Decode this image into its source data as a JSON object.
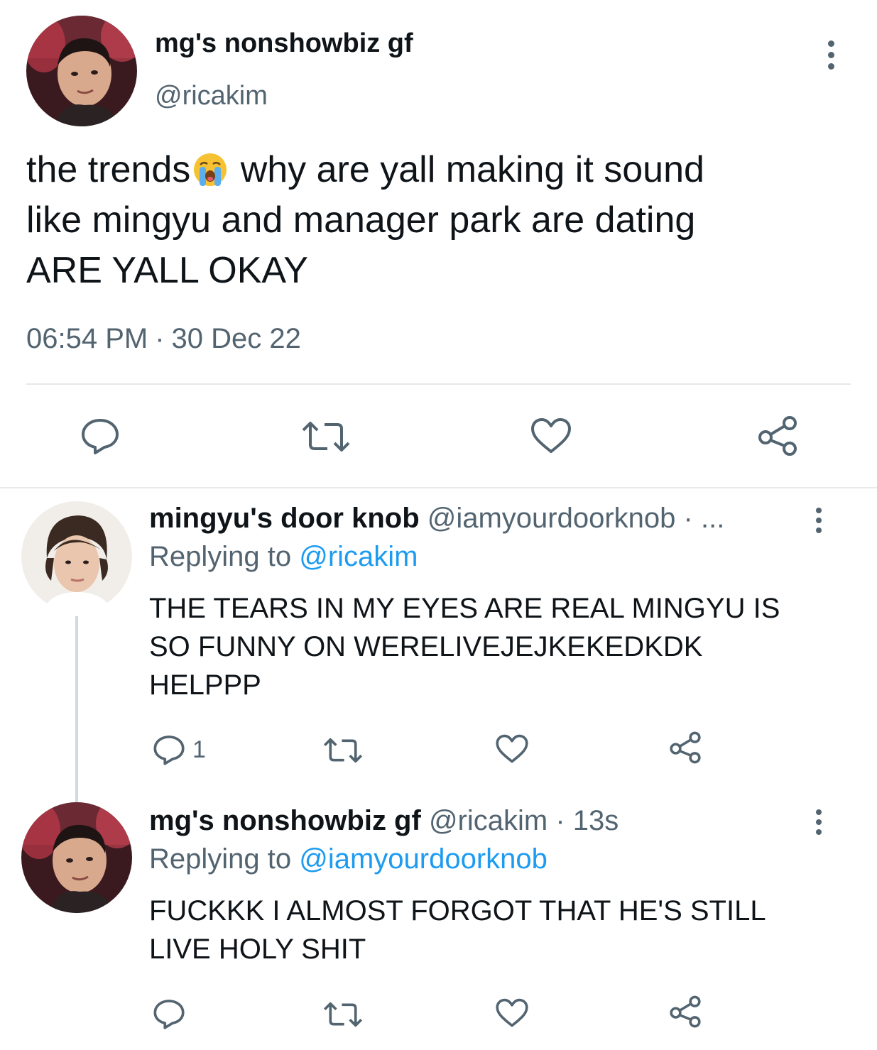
{
  "main_tweet": {
    "display_name": "mg's nonshowbiz gf",
    "handle": "@ricakim",
    "text_lines": [
      "the trends",
      " why are yall making it sound",
      "like mingyu and manager park are dating",
      "ARE YALL OKAY"
    ],
    "emoji_icon": "loudly-crying-face-emoji",
    "time": "06:54 PM",
    "separator": "·",
    "date": "30 Dec 22",
    "actions": [
      "reply-icon",
      "retweet-icon",
      "like-icon",
      "share-icon"
    ]
  },
  "replies": [
    {
      "display_name": "mingyu's door knob",
      "handle": "@iamyourdoorknob",
      "meta": " · ...",
      "replying_label": "Replying to ",
      "replying_to": "@ricakim",
      "text_lines": [
        "THE TEARS IN MY EYES ARE REAL MINGYU IS",
        "SO FUNNY ON WERELIVEJEJKEKEDKDK",
        "HELPPP"
      ],
      "reply_count": "1"
    },
    {
      "display_name": "mg's nonshowbiz gf",
      "handle": "@ricakim",
      "meta": " · 13s",
      "replying_label": "Replying to ",
      "replying_to": "@iamyourdoorknob",
      "text_lines": [
        "FUCKKK I ALMOST FORGOT THAT HE'S STILL",
        "LIVE HOLY SHIT"
      ],
      "reply_count": ""
    }
  ],
  "colors": {
    "text": "#0f1419",
    "secondary": "#536471",
    "link": "#1d9bf0",
    "divider": "#e5e9ec"
  }
}
